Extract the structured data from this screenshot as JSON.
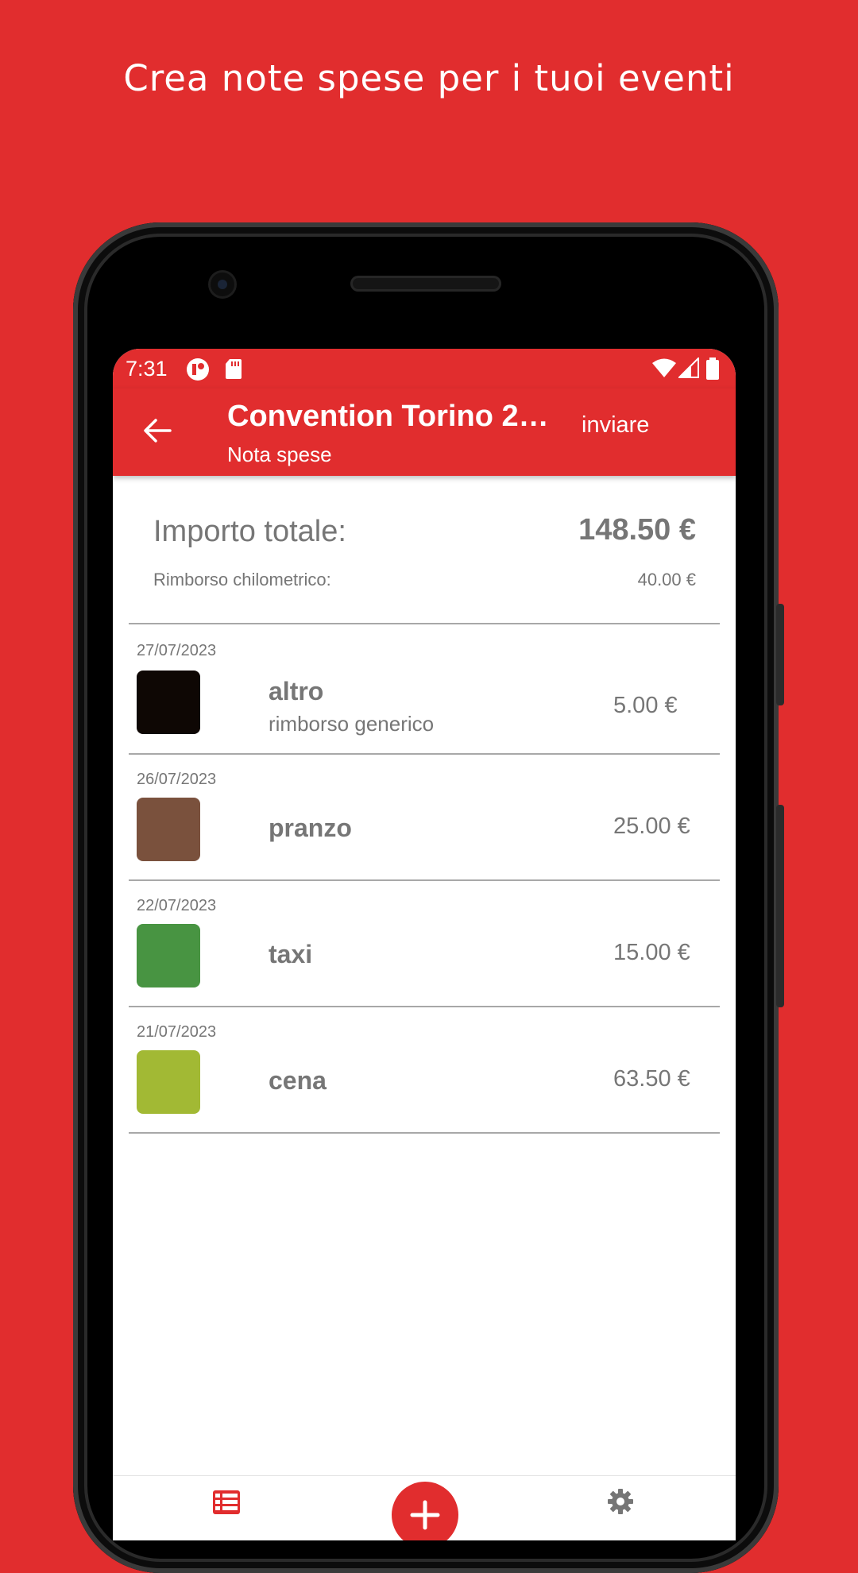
{
  "headline": "Crea note spese per i tuoi eventi",
  "status": {
    "time": "7:31"
  },
  "appbar": {
    "title": "Convention Torino 2…",
    "subtitle": "Nota spese",
    "action": "inviare"
  },
  "summary": {
    "total_label": "Importo totale:",
    "total_value": "148.50 €",
    "km_label": "Rimborso chilometrico:",
    "km_value": "40.00 €"
  },
  "expenses": [
    {
      "date": "27/07/2023",
      "name": "altro",
      "description": "rimborso generico",
      "amount": "5.00 €",
      "color": "#0e0704"
    },
    {
      "date": "26/07/2023",
      "name": "pranzo",
      "description": "",
      "amount": "25.00 €",
      "color": "#7a513d"
    },
    {
      "date": "22/07/2023",
      "name": "taxi",
      "description": "",
      "amount": "15.00 €",
      "color": "#489442"
    },
    {
      "date": "21/07/2023",
      "name": "cena",
      "description": "",
      "amount": "63.50 €",
      "color": "#a2b934"
    }
  ],
  "colors": {
    "accent": "#e12d2e",
    "text_gray": "#767676"
  },
  "icons": {
    "back": "arrow-left-icon",
    "list": "list-icon",
    "add": "plus-icon",
    "settings": "gear-icon"
  }
}
